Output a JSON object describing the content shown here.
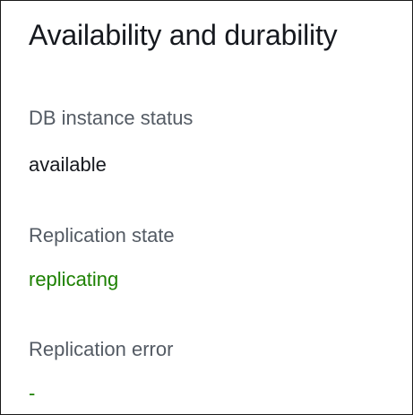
{
  "section": {
    "title": "Availability and durability"
  },
  "fields": [
    {
      "label": "DB instance status",
      "value": "available",
      "value_color": "#16191f"
    },
    {
      "label": "Replication state",
      "value": "replicating",
      "value_color": "#1d8102"
    },
    {
      "label": "Replication error",
      "value": "-",
      "value_color": "#1d8102"
    }
  ]
}
